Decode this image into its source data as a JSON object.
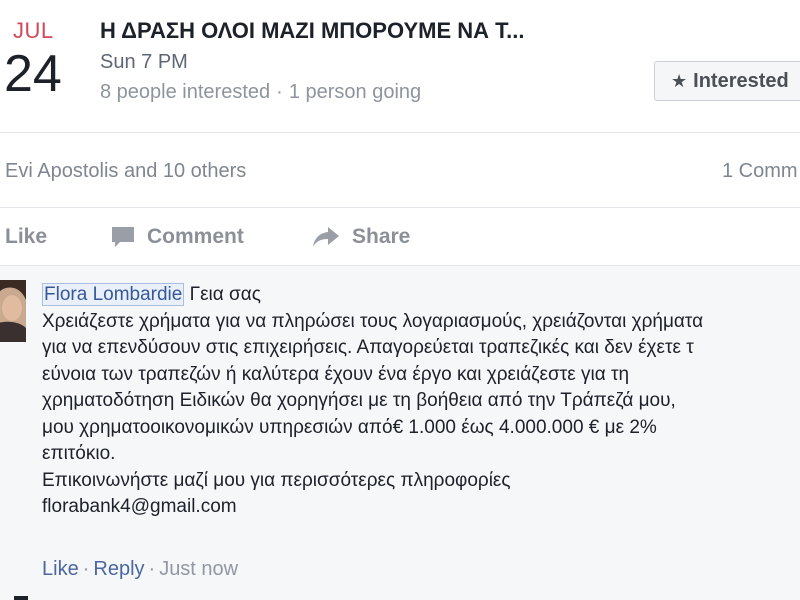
{
  "event": {
    "month": "JUL",
    "day": "24",
    "title": "Η ΔΡΑΣΗ ΟΛΟΙ ΜΑΖΙ ΜΠΟΡΟΥΜΕ ΝΑ Τ...",
    "time": "Sun 7 PM",
    "interested_count": "8 people interested",
    "stats_separator": "·",
    "going_count": "1 person going",
    "interested_button": "Interested",
    "interested_icon": "star-icon"
  },
  "likes": {
    "names": "Evi Apostolis and 10 others",
    "comment_count": "1 Comm"
  },
  "actions": {
    "like": "Like",
    "comment": "Comment",
    "share": "Share"
  },
  "comment": {
    "author": "Flora Lombardie",
    "greeting": " Γεια σας",
    "lines": [
      "Χρειάζεστε χρήματα για να πληρώσει τους λογαριασμούς, χρειάζονται χρήματα",
      "για να επενδύσουν στις επιχειρήσεις. Απαγορεύεται τραπεζικές και δεν έχετε τ",
      "εύνοια των τραπεζών ή καλύτερα έχουν ένα έργο και χρειάζεστε για τη",
      "χρηματοδότηση Ειδικών θα χορηγήσει με τη βοήθεια από την Τράπεζά μου,",
      "μου χρηματοοικονομικών υπηρεσιών από€ 1.000 έως 4.000.000 € με 2%",
      "επιτόκιο.",
      "Επικοινωνήστε μαζί μου για περισσότερες πληροφορίες",
      "florabank4@gmail.com"
    ],
    "like_label": "Like",
    "reply_label": "Reply",
    "separator": "·",
    "time": "Just now"
  }
}
